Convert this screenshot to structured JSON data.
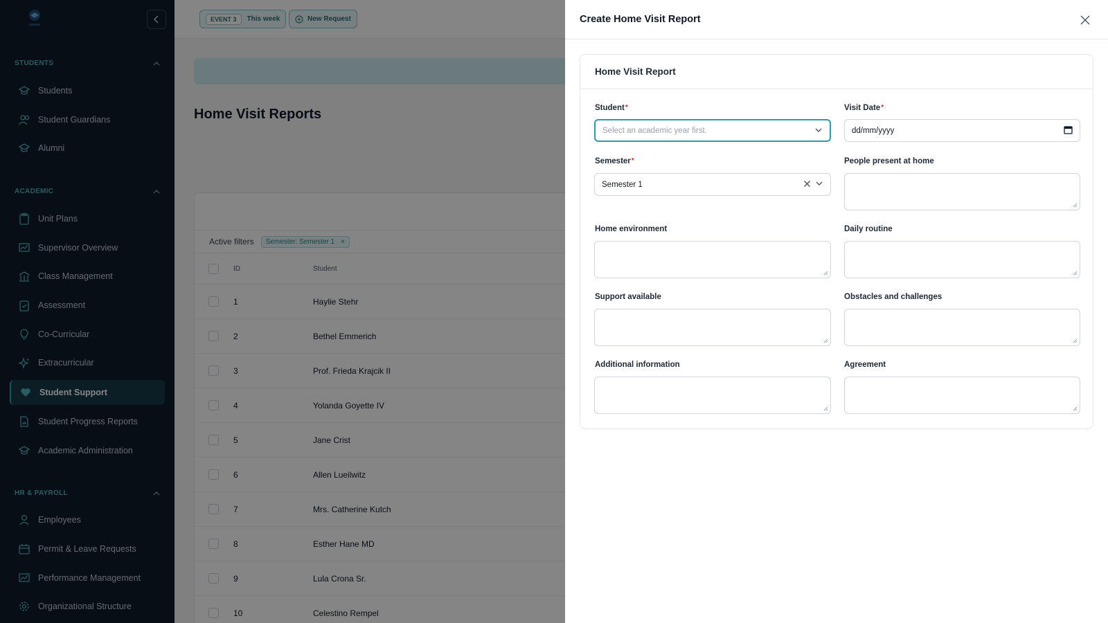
{
  "sidebar": {
    "sections": [
      {
        "title": "STUDENTS",
        "items": [
          {
            "label": "Students",
            "icon": "graduation-cap-icon"
          },
          {
            "label": "Student Guardians",
            "icon": "users-icon"
          },
          {
            "label": "Alumni",
            "icon": "graduation-cap-icon"
          }
        ]
      },
      {
        "title": "ACADEMIC",
        "items": [
          {
            "label": "Unit Plans",
            "icon": "clipboard-icon"
          },
          {
            "label": "Supervisor Overview",
            "icon": "chart-icon"
          },
          {
            "label": "Class Management",
            "icon": "building-icon"
          },
          {
            "label": "Assessment",
            "icon": "clipboard-check-icon"
          },
          {
            "label": "Co-Curricular",
            "icon": "lightbulb-icon"
          },
          {
            "label": "Extracurricular",
            "icon": "sparkles-icon"
          },
          {
            "label": "Student Support",
            "icon": "heart-icon"
          },
          {
            "label": "Student Progress Reports",
            "icon": "document-chart-icon"
          },
          {
            "label": "Academic Administration",
            "icon": "graduation-cap-icon"
          }
        ]
      },
      {
        "title": "HR & PAYROLL",
        "items": [
          {
            "label": "Employees",
            "icon": "user-icon"
          },
          {
            "label": "Permit & Leave Requests",
            "icon": "calendar-icon"
          },
          {
            "label": "Performance Management",
            "icon": "chart-icon"
          },
          {
            "label": "Organizational Structure",
            "icon": "gear-icon"
          }
        ]
      }
    ],
    "active": "Student Support"
  },
  "topbar": {
    "event_tag": "EVENT 3",
    "event_label": "This week",
    "new_request": "New Request"
  },
  "main": {
    "title": "Home Visit Reports",
    "active_filters_label": "Active filters",
    "filter_chip": "Semester: Semester 1",
    "columns": [
      "ID",
      "Student"
    ],
    "rows": [
      {
        "id": "1",
        "student": "Haylie Stehr"
      },
      {
        "id": "2",
        "student": "Bethel Emmerich"
      },
      {
        "id": "3",
        "student": "Prof. Frieda Krajcik II"
      },
      {
        "id": "4",
        "student": "Yolanda Goyette IV"
      },
      {
        "id": "5",
        "student": "Jane Crist"
      },
      {
        "id": "6",
        "student": "Allen Lueilwitz"
      },
      {
        "id": "7",
        "student": "Mrs. Catherine Kutch"
      },
      {
        "id": "8",
        "student": "Esther Hane MD"
      },
      {
        "id": "9",
        "student": "Lula Crona Sr."
      },
      {
        "id": "10",
        "student": "Celestino Rempel"
      }
    ]
  },
  "panel": {
    "title": "Create Home Visit Report",
    "card_title": "Home Visit Report",
    "fields": {
      "student_label": "Student",
      "student_placeholder": "Select an academic year first.",
      "visit_date_label": "Visit Date",
      "visit_date_value": "dd/mm/yyyy",
      "semester_label": "Semester",
      "semester_value": "Semester 1",
      "people_label": "People present at home",
      "home_env_label": "Home environment",
      "daily_routine_label": "Daily routine",
      "support_label": "Support available",
      "obstacles_label": "Obstacles and challenges",
      "additional_label": "Additional information",
      "agreement_label": "Agreement"
    }
  },
  "colors": {
    "sidebar_bg": "#0f1b29",
    "accent": "#2a9dab",
    "required": "#dc2626"
  }
}
